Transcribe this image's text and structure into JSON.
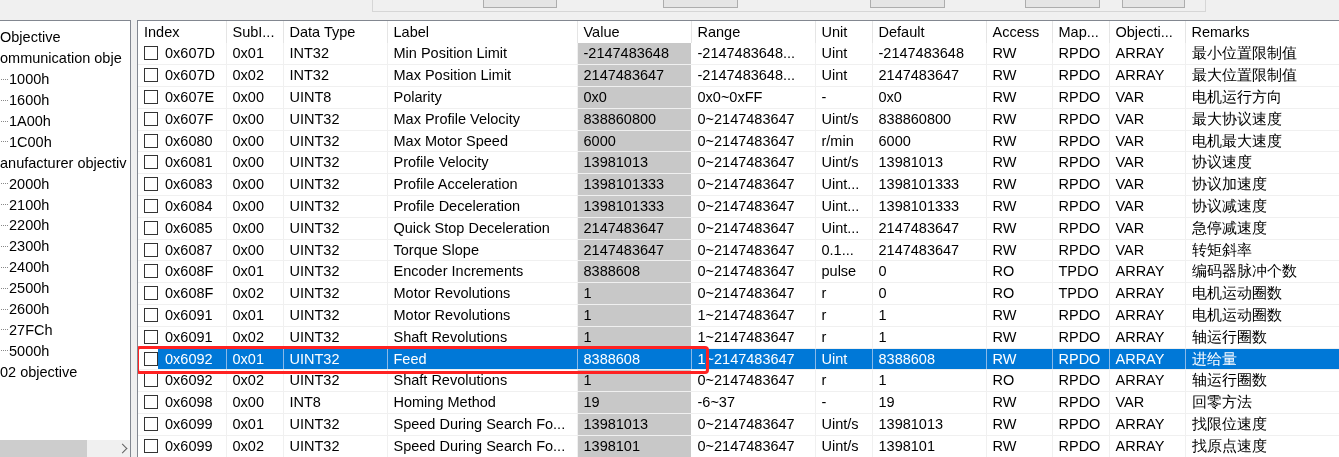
{
  "tree": [
    {
      "label": "Objective",
      "children": [
        {
          "label": "ommunication obje",
          "children": [
            {
              "label": "1000h"
            },
            {
              "label": "1600h"
            },
            {
              "label": "1A00h"
            },
            {
              "label": "1C00h"
            }
          ]
        },
        {
          "label": "anufacturer objectiv",
          "children": [
            {
              "label": "2000h"
            },
            {
              "label": "2100h"
            },
            {
              "label": "2200h"
            },
            {
              "label": "2300h"
            },
            {
              "label": "2400h"
            },
            {
              "label": "2500h"
            },
            {
              "label": "2600h"
            },
            {
              "label": "27FCh"
            },
            {
              "label": "5000h"
            }
          ]
        },
        {
          "label": "02 objective"
        }
      ]
    }
  ],
  "table": {
    "columns": [
      "Index",
      "SubI...",
      "Data Type",
      "Label",
      "Value",
      "Range",
      "Unit",
      "Default",
      "Access",
      "Map...",
      "Objecti...",
      "Remarks"
    ],
    "rows": [
      {
        "cells": [
          "0x607D",
          "0x01",
          "INT32",
          "Min Position Limit",
          "-2147483648",
          "-2147483648...",
          "Uint",
          "-2147483648",
          "RW",
          "RPDO",
          "ARRAY",
          "最小位置限制值"
        ],
        "checked": false,
        "selected": false,
        "highlighted": false
      },
      {
        "cells": [
          "0x607D",
          "0x02",
          "INT32",
          "Max Position Limit",
          "2147483647",
          "-2147483648...",
          "Uint",
          "2147483647",
          "RW",
          "RPDO",
          "ARRAY",
          "最大位置限制值"
        ],
        "checked": false,
        "selected": false,
        "highlighted": false
      },
      {
        "cells": [
          "0x607E",
          "0x00",
          "UINT8",
          "Polarity",
          "0x0",
          "0x0~0xFF",
          "-",
          "0x0",
          "RW",
          "RPDO",
          "VAR",
          "电机运行方向"
        ],
        "checked": false,
        "selected": false,
        "highlighted": false
      },
      {
        "cells": [
          "0x607F",
          "0x00",
          "UINT32",
          "Max Profile Velocity",
          "838860800",
          "0~2147483647",
          "Uint/s",
          "838860800",
          "RW",
          "RPDO",
          "VAR",
          "最大协议速度"
        ],
        "checked": false,
        "selected": false,
        "highlighted": false
      },
      {
        "cells": [
          "0x6080",
          "0x00",
          "UINT32",
          "Max Motor Speed",
          "6000",
          "0~2147483647",
          "r/min",
          "6000",
          "RW",
          "RPDO",
          "VAR",
          "电机最大速度"
        ],
        "checked": false,
        "selected": false,
        "highlighted": false
      },
      {
        "cells": [
          "0x6081",
          "0x00",
          "UINT32",
          "Profile Velocity",
          "13981013",
          "0~2147483647",
          "Uint/s",
          "13981013",
          "RW",
          "RPDO",
          "VAR",
          "协议速度"
        ],
        "checked": false,
        "selected": false,
        "highlighted": false
      },
      {
        "cells": [
          "0x6083",
          "0x00",
          "UINT32",
          "Profile Acceleration",
          "1398101333",
          "0~2147483647",
          "Uint...",
          "1398101333",
          "RW",
          "RPDO",
          "VAR",
          "协议加速度"
        ],
        "checked": false,
        "selected": false,
        "highlighted": false
      },
      {
        "cells": [
          "0x6084",
          "0x00",
          "UINT32",
          "Profile Deceleration",
          "1398101333",
          "0~2147483647",
          "Uint...",
          "1398101333",
          "RW",
          "RPDO",
          "VAR",
          "协议减速度"
        ],
        "checked": false,
        "selected": false,
        "highlighted": false
      },
      {
        "cells": [
          "0x6085",
          "0x00",
          "UINT32",
          "Quick Stop Deceleration",
          "2147483647",
          "0~2147483647",
          "Uint...",
          "2147483647",
          "RW",
          "RPDO",
          "VAR",
          "急停减速度"
        ],
        "checked": false,
        "selected": false,
        "highlighted": false
      },
      {
        "cells": [
          "0x6087",
          "0x00",
          "UINT32",
          "Torque Slope",
          "2147483647",
          "0~2147483647",
          "0.1...",
          "2147483647",
          "RW",
          "RPDO",
          "VAR",
          "转矩斜率"
        ],
        "checked": false,
        "selected": false,
        "highlighted": false
      },
      {
        "cells": [
          "0x608F",
          "0x01",
          "UINT32",
          "Encoder Increments",
          "8388608",
          "0~2147483647",
          "pulse",
          "0",
          "RO",
          "TPDO",
          "ARRAY",
          "编码器脉冲个数"
        ],
        "checked": false,
        "selected": false,
        "highlighted": false
      },
      {
        "cells": [
          "0x608F",
          "0x02",
          "UINT32",
          "Motor Revolutions",
          "1",
          "0~2147483647",
          "r",
          "0",
          "RO",
          "TPDO",
          "ARRAY",
          "电机运动圈数"
        ],
        "checked": false,
        "selected": false,
        "highlighted": false
      },
      {
        "cells": [
          "0x6091",
          "0x01",
          "UINT32",
          "Motor Revolutions",
          "1",
          "1~2147483647",
          "r",
          "1",
          "RW",
          "RPDO",
          "ARRAY",
          "电机运动圈数"
        ],
        "checked": false,
        "selected": false,
        "highlighted": false
      },
      {
        "cells": [
          "0x6091",
          "0x02",
          "UINT32",
          "Shaft Revolutions",
          "1",
          "1~2147483647",
          "r",
          "1",
          "RW",
          "RPDO",
          "ARRAY",
          "轴运行圈数"
        ],
        "checked": false,
        "selected": false,
        "highlighted": false
      },
      {
        "cells": [
          "0x6092",
          "0x01",
          "UINT32",
          "Feed",
          "8388608",
          "1~2147483647",
          "Uint",
          "8388608",
          "RW",
          "RPDO",
          "ARRAY",
          "进给量"
        ],
        "checked": false,
        "selected": true,
        "highlighted": true
      },
      {
        "cells": [
          "0x6092",
          "0x02",
          "UINT32",
          "Shaft Revolutions",
          "1",
          "0~2147483647",
          "r",
          "1",
          "RO",
          "RPDO",
          "ARRAY",
          "轴运行圈数"
        ],
        "checked": false,
        "selected": false,
        "highlighted": false
      },
      {
        "cells": [
          "0x6098",
          "0x00",
          "INT8",
          "Homing Method",
          "19",
          "-6~37",
          "-",
          "19",
          "RW",
          "RPDO",
          "VAR",
          "回零方法"
        ],
        "checked": false,
        "selected": false,
        "highlighted": false
      },
      {
        "cells": [
          "0x6099",
          "0x01",
          "UINT32",
          "Speed During Search Fo...",
          "13981013",
          "0~2147483647",
          "Uint/s",
          "13981013",
          "RW",
          "RPDO",
          "ARRAY",
          "找限位速度"
        ],
        "checked": false,
        "selected": false,
        "highlighted": false
      },
      {
        "cells": [
          "0x6099",
          "0x02",
          "UINT32",
          "Speed During Search Fo...",
          "1398101",
          "0~2147483647",
          "Uint/s",
          "1398101",
          "RW",
          "RPDO",
          "ARRAY",
          "找原点速度"
        ],
        "checked": false,
        "selected": false,
        "highlighted": false
      }
    ]
  }
}
